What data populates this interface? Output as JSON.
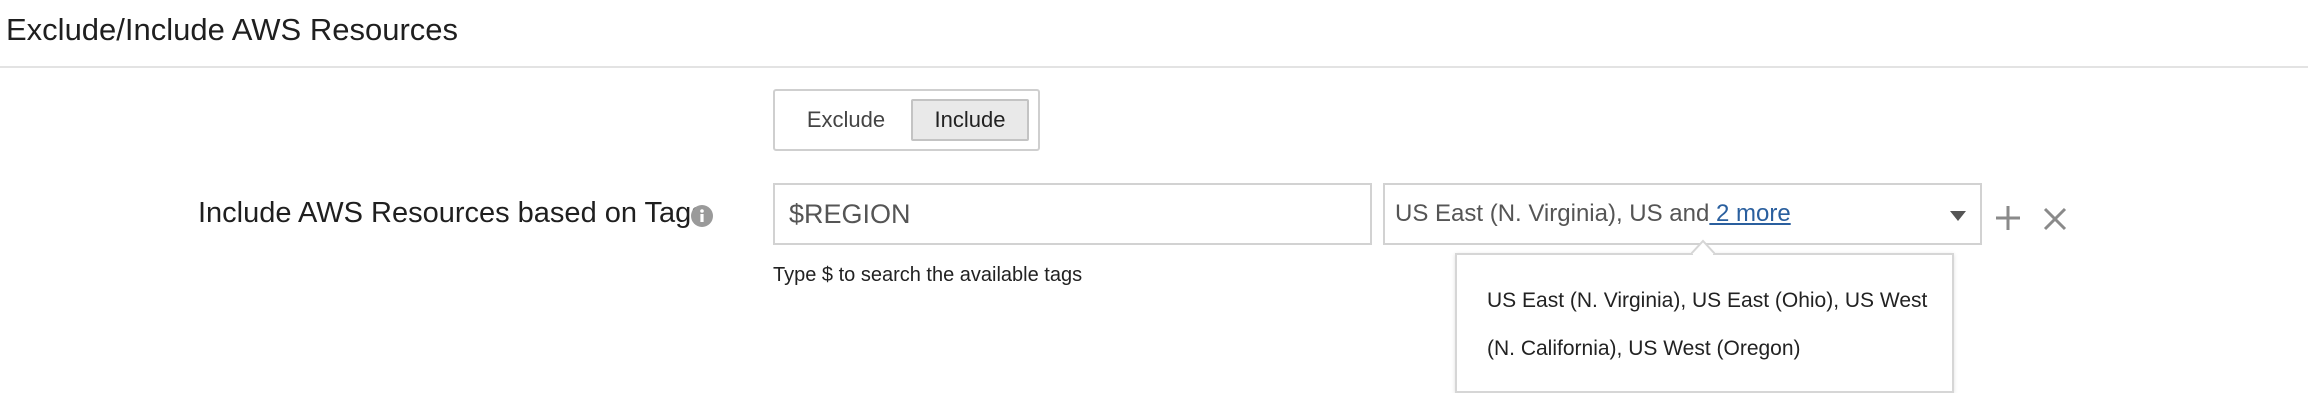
{
  "section": {
    "title": "Exclude/Include AWS Resources"
  },
  "mode_toggle": {
    "exclude_label": "Exclude",
    "include_label": "Include",
    "selected": "Include"
  },
  "tags_row": {
    "label": "Include AWS Resources based on Tags",
    "info_icon": "info-icon",
    "tag_input_value": "$REGION",
    "hint": "Type $ to search the available tags",
    "region_select": {
      "text": "US East (N. Virginia), US and",
      "more_link": " 2 more",
      "caret_icon": "caret-down-icon"
    },
    "add_icon": "plus-icon",
    "remove_icon": "close-icon"
  },
  "tooltip": {
    "text": "US East (N. Virginia), US East (Ohio), US West (N. California), US West (Oregon)"
  },
  "colors": {
    "link": "#2a5f9e",
    "border": "#d2d2d2",
    "selected_toggle_bg": "#e9e9e9"
  }
}
